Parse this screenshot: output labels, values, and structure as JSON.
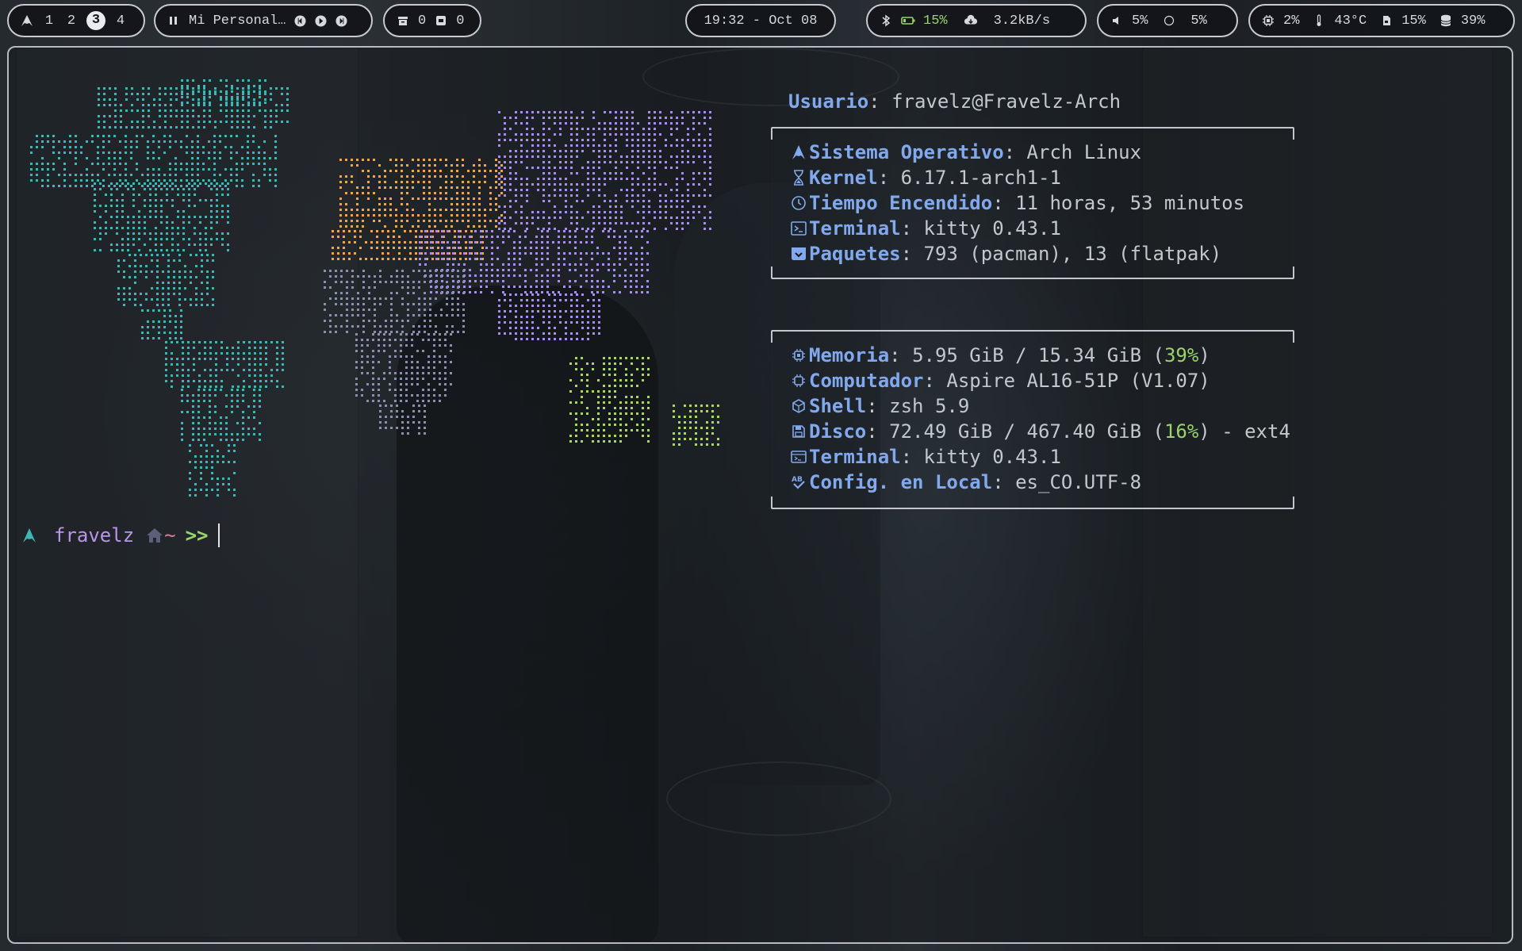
{
  "topbar": {
    "workspaces": [
      "1",
      "2",
      "3",
      "4"
    ],
    "active_workspace": "3",
    "media_title": "Mi Personal…",
    "tray_count_1": "0",
    "tray_count_2": "0",
    "clock": "19:32 - Oct 08",
    "battery": "15%",
    "network_speed": "3.2kB/s",
    "volume": "5%",
    "brightness": "5%",
    "cpu": "2%",
    "temperature": "43°C",
    "memory_short": "15%",
    "disk_short": "39%"
  },
  "fetch": {
    "user_label": "Usuario",
    "user_value": "fravelz@Fravelz-Arch",
    "block1": [
      {
        "icon": "arch-icon",
        "label": "Sistema Operativo",
        "value": "Arch Linux"
      },
      {
        "icon": "hourglass-icon",
        "label": "Kernel",
        "value": "6.17.1-arch1-1"
      },
      {
        "icon": "clock-icon",
        "label": "Tiempo Encendido",
        "value": "11 horas, 53 minutos"
      },
      {
        "icon": "terminal-icon",
        "label": "Terminal",
        "value": "kitty 0.43.1"
      },
      {
        "icon": "package-icon",
        "label": "Paquetes",
        "value": "793 (pacman), 13 (flatpak)"
      }
    ],
    "block2": {
      "memory_label": "Memoria",
      "memory_value": "5.95 GiB / 15.34 GiB (",
      "memory_pct": "39%",
      "memory_close": ")",
      "computer_label": "Computador",
      "computer_value": "Aspire AL16-51P (V1.07)",
      "shell_label": "Shell",
      "shell_value": "zsh 5.9",
      "disk_label": "Disco",
      "disk_value": "72.49 GiB / 467.40 GiB (",
      "disk_pct": "16%",
      "disk_tail": ") - ext4",
      "terminal_label": "Terminal",
      "terminal_value": "kitty 0.43.1",
      "locale_label": "Config. en Local",
      "locale_value": "es_CO.UTF-8"
    }
  },
  "prompt": {
    "user": "fravelz",
    "dir": "~",
    "symbol": ">>"
  },
  "colors": {
    "americas": "#3fb6b6",
    "europe": "#f0a44c",
    "asia": "#a88cf0",
    "africa": "#8a8fb0",
    "oceania": "#a8d860",
    "label": "#82a9ee",
    "accent_green": "#9bd46a"
  }
}
